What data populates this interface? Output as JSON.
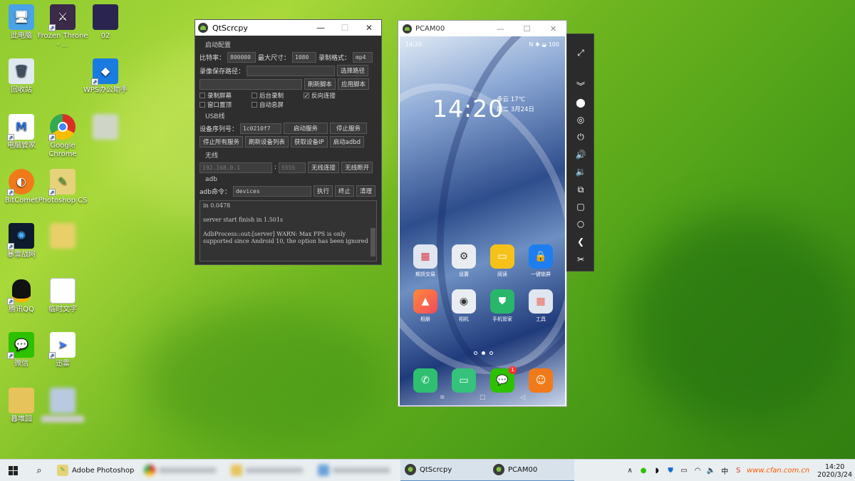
{
  "desktop": {
    "icons": [
      {
        "label": "此电脑"
      },
      {
        "label": "Frozen Throne - ..."
      },
      {
        "label": "02"
      },
      {
        "label": "回收站"
      },
      {
        "label": "WPS办公助手"
      },
      {
        "label": "电脑管家"
      },
      {
        "label": "Google Chrome"
      },
      {
        "label": "BitComet"
      },
      {
        "label": "Photoshop CS"
      },
      {
        "label": "暴雪战网"
      },
      {
        "label": "腾讯QQ"
      },
      {
        "label": "临时文字"
      },
      {
        "label": "微信"
      },
      {
        "label": "迅雷"
      },
      {
        "label": "暮堆园"
      }
    ]
  },
  "qt": {
    "title": "QtScrcpy",
    "startup_group": "启动配置",
    "bitrate_label": "比特率：",
    "bitrate_value": "800000",
    "maxsize_label": "最大尺寸：",
    "maxsize_value": "1080",
    "format_label": "录制格式：",
    "format_value": "mp4",
    "record_path_label": "录像保存路径：",
    "select_path_btn": "选择路径",
    "refresh_script_btn": "刷新脚本",
    "apply_script_btn": "应用脚本",
    "cb_record_screen": "录制屏幕",
    "cb_bg_record": "后台录制",
    "cb_reverse": "反向连接",
    "cb_window_top": "窗口置顶",
    "cb_auto_off": "自动息屏",
    "usb_group": "USB线",
    "serial_label": "设备序列号：",
    "serial_value": "1c0210f7",
    "start_service_btn": "启动服务",
    "stop_service_btn": "停止服务",
    "stop_all_btn": "停止所有服务",
    "refresh_devices_btn": "刷新设备列表",
    "get_ip_btn": "获取设备IP",
    "start_adbd_btn": "启动adbd",
    "wireless_group": "无线",
    "ip_placeholder": "192.168.0.1",
    "port_placeholder": "5555",
    "wireless_connect_btn": "无线连接",
    "wireless_disconnect_btn": "无线断开",
    "adb_group": "adb",
    "adb_cmd_label": "adb命令：",
    "adb_cmd_value": "devices",
    "exec_btn": "执行",
    "terminate_btn": "终止",
    "clear_btn": "清理",
    "log_lines": [
      "in 0.0478",
      "server start finish in 1.501s",
      "AdbProcess::out:[server] WARN: Max FPS is only supported since Android 10, the option has been ignored"
    ]
  },
  "phone": {
    "title": "PCAM00",
    "status_time": "14:20",
    "status_right": "N ✱ ◒ 100",
    "clock": "14:20",
    "weather": "多云 17℃",
    "date": "周二 3月24日",
    "apps_row1": [
      "期货交易",
      "设置",
      "阅读",
      "一键锁屏"
    ],
    "apps_row2": [
      "相册",
      "相机",
      "手机管家",
      "工具"
    ],
    "wechat_badge": "1"
  },
  "taskbar": {
    "apps": [
      {
        "label": "Adobe Photoshop"
      },
      {
        "label": "QtScrcpy"
      },
      {
        "label": "PCAM00"
      }
    ],
    "ime": "中",
    "time": "14:20",
    "date": "2020/3/24",
    "watermark": "www.cfan.com.cn"
  }
}
